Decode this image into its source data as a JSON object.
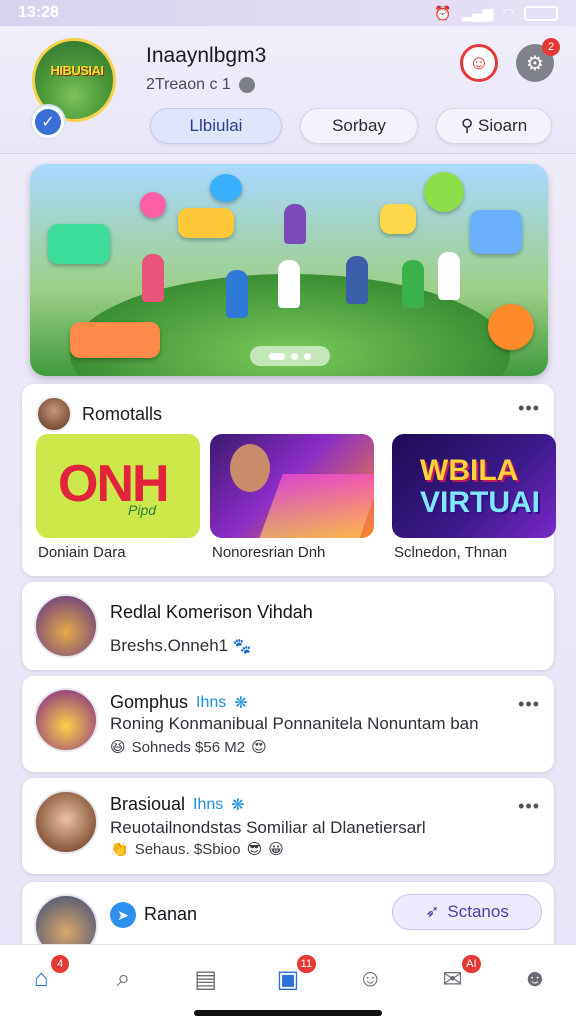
{
  "status": {
    "time": "13:28",
    "signal": "5G"
  },
  "header": {
    "profile_logo_text": "HIBUSIAI",
    "username": "Inaaynlbgm3",
    "subline": "2Treaon c 1",
    "notification_count": "2",
    "pills": [
      {
        "label": "Llbiulai"
      },
      {
        "label": "Sorbay"
      },
      {
        "label": "Sioarn"
      }
    ]
  },
  "banner": {
    "dots": 3,
    "active_dot": 0
  },
  "recommendations": {
    "title": "Romotalls",
    "more": "•••",
    "items": [
      {
        "thumb_text": "ONH",
        "thumb_sub": "Pipd",
        "caption": "Doniain     Dara"
      },
      {
        "caption": "Nonoresrian   Dnh"
      },
      {
        "thumb_line1": "WBILA",
        "thumb_line2": "VIRTUAI",
        "caption": "Sclnedon,   Thnan"
      }
    ]
  },
  "feed": [
    {
      "title": "Redlal Komerison Vihdah",
      "line": "Breshs.Onneh1"
    },
    {
      "title": "Gomphus",
      "tag": "Ihns",
      "line": "Roning Konmanibual Ponnanitela Nonuntam ban",
      "meta": "Sohneds  $56 M2",
      "more": "•••"
    },
    {
      "title": "Brasioual",
      "tag": "Ihns",
      "line": "Reuotailnondstas Somiliar al Dlanetiersarl",
      "meta": "Sehaus.  $Sbioo",
      "more": "•••"
    },
    {
      "title": "Ranan",
      "button": "Sctanos"
    }
  ],
  "bottom_nav": {
    "home_badge": "4",
    "video_badge": "11",
    "chat_badge": "AI"
  },
  "colors": {
    "accent": "#2f6fd8",
    "badge": "#e53935",
    "tag": "#1f8fdc"
  }
}
